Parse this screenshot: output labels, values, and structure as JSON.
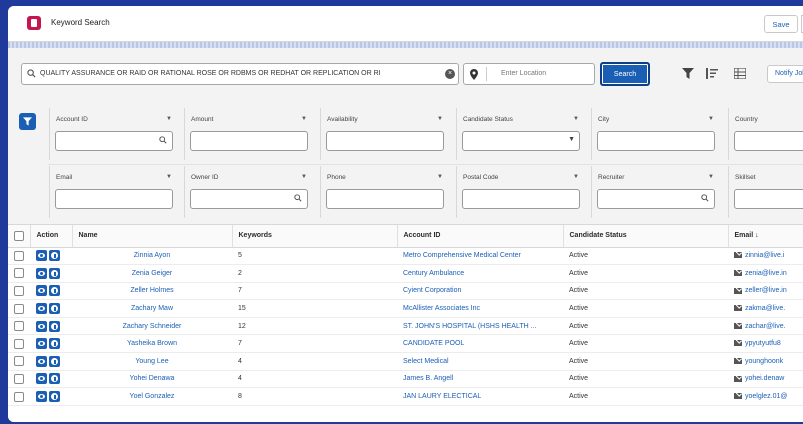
{
  "header": {
    "title": "Keyword Search",
    "save_label": "Save"
  },
  "search": {
    "keywords_value": "QUALITY ASSURANCE OR RAID OR RATIONAL ROSE OR RDBMS OR REDHAT OR REPLICATION OR RI",
    "location_placeholder": "Enter Location",
    "search_label": "Search",
    "notify_label": "Notify Jobs"
  },
  "filters": {
    "row1": [
      "Account ID",
      "Amount",
      "Availability",
      "Candidate Status",
      "City",
      "Country"
    ],
    "row2": [
      "Email",
      "Owner ID",
      "Phone",
      "Postal Code",
      "Recruiter",
      "Skillset"
    ]
  },
  "table": {
    "columns": {
      "action": "Action",
      "name": "Name",
      "keywords": "Keywords",
      "account": "Account ID",
      "status": "Candidate Status",
      "email": "Email ↓"
    },
    "rows": [
      {
        "name": "Zinnia Ayon",
        "keywords": "5",
        "account": "Metro Comprehensive Medical Center",
        "status": "Active",
        "email": "zinnia@live.i"
      },
      {
        "name": "Zenia Geiger",
        "keywords": "2",
        "account": "Century Ambulance",
        "status": "Active",
        "email": "zenia@live.in"
      },
      {
        "name": "Zeller Holmes",
        "keywords": "7",
        "account": "Cyient Corporation",
        "status": "Active",
        "email": "zeller@live.in"
      },
      {
        "name": "Zachary Maw",
        "keywords": "15",
        "account": "McAllister Associates Inc",
        "status": "Active",
        "email": "zakma@live."
      },
      {
        "name": "Zachary Schneider",
        "keywords": "12",
        "account": "ST. JOHN'S HOSPITAL (HSHS HEALTH ...",
        "status": "Active",
        "email": "zachar@live."
      },
      {
        "name": "Yasheika Brown",
        "keywords": "7",
        "account": "CANDIDATE POOL",
        "status": "Active",
        "email": "ypyutyutfu8"
      },
      {
        "name": "Young Lee",
        "keywords": "4",
        "account": "Select Medical",
        "status": "Active",
        "email": "younghoonk"
      },
      {
        "name": "Yohei Denawa",
        "keywords": "4",
        "account": "James B. Angell",
        "status": "Active",
        "email": "yohei.denaw"
      },
      {
        "name": "Yoel Gonzalez",
        "keywords": "8",
        "account": "JAN LAURY ELECTICAL",
        "status": "Active",
        "email": "yoelglez.01@"
      }
    ]
  }
}
